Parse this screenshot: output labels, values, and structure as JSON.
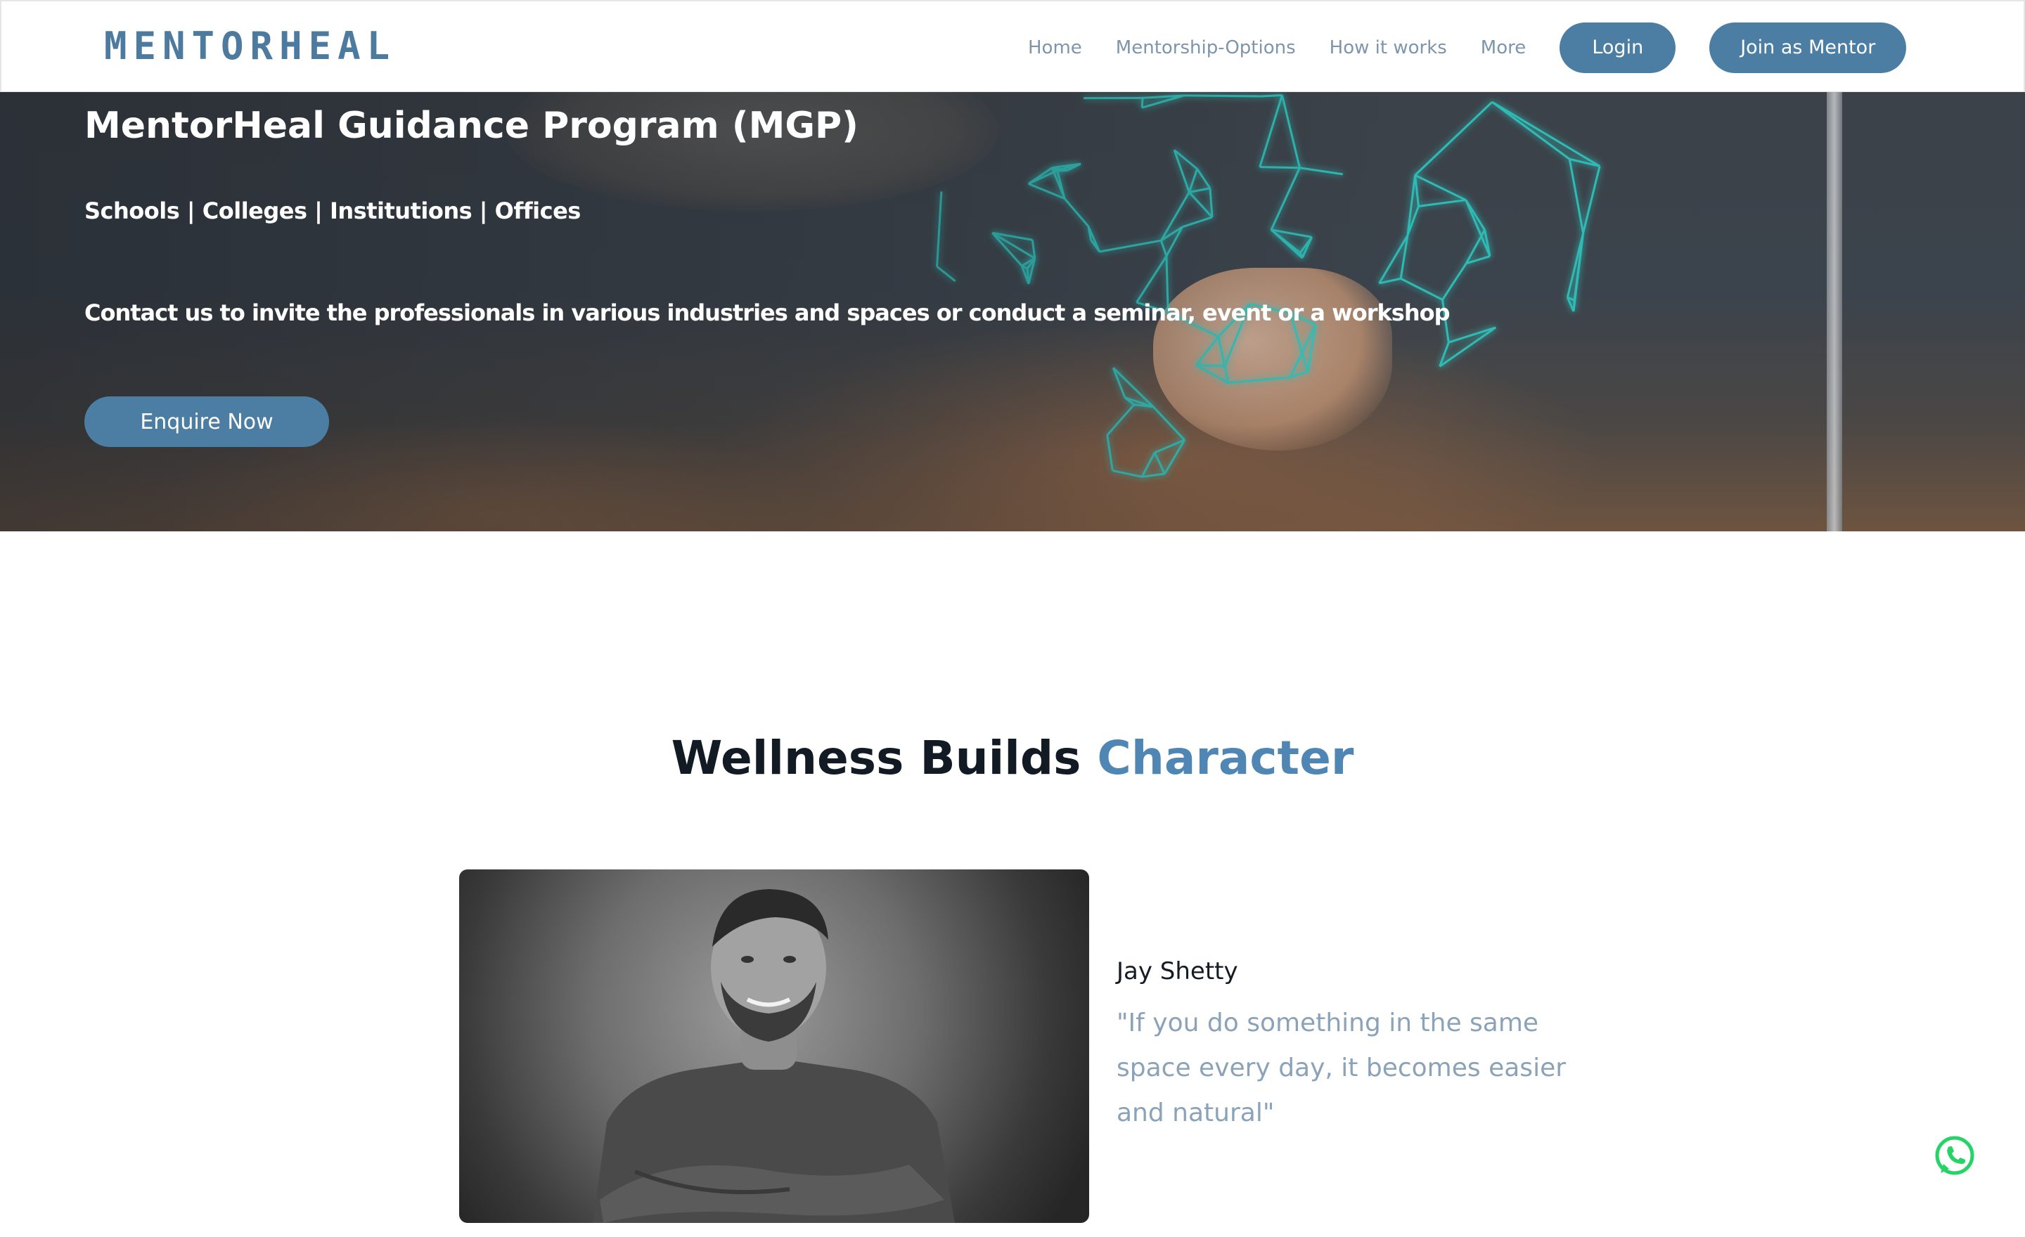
{
  "header": {
    "logo_text": "MENTORHEAL",
    "nav": [
      "Home",
      "Mentorship-Options",
      "How it works",
      "More"
    ],
    "login_label": "Login",
    "join_label": "Join as Mentor"
  },
  "hero": {
    "title": "MentorHeal Guidance Program (MGP)",
    "subtitle": "Schools | Colleges | Institutions | Offices",
    "description": "Contact us to invite the professionals in various industries and spaces or conduct a seminar, event or a workshop",
    "cta_label": "Enquire Now"
  },
  "wellness": {
    "title_part1": "Wellness Builds",
    "title_part2": "Character",
    "testimonial": {
      "name": "Jay Shetty",
      "quote": "\"If you do something in the same space every day, it becomes easier and natural\""
    }
  },
  "colors": {
    "brand": "#4c7ea4",
    "accent": "#4f86b3",
    "nav_text": "#7e95ab",
    "quote_text": "#8aa3b9",
    "mesh": "#2fc7c0",
    "whatsapp": "#25d366"
  },
  "icons": {
    "whatsapp": "whatsapp-icon"
  }
}
